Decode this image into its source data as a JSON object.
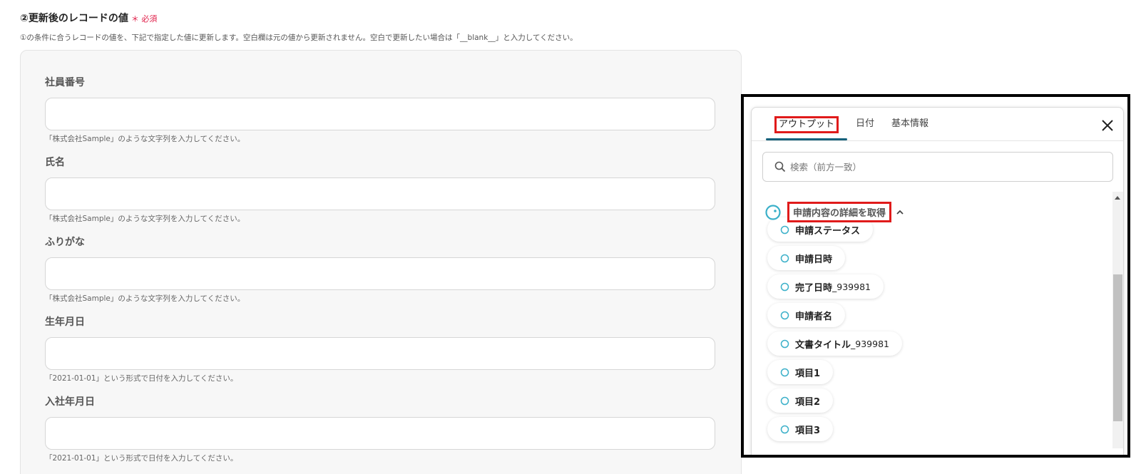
{
  "section": {
    "title": "②更新後のレコードの値",
    "required_mark": "＊ 必須",
    "description": "①の条件に合うレコードの値を、下記で指定した値に更新します。空白欄は元の値から更新されません。空白で更新したい場合は「__blank__」と入力してください。"
  },
  "fields": [
    {
      "label": "社員番号",
      "value": "",
      "hint": "「株式会社Sample」のような文字列を入力してください。"
    },
    {
      "label": "氏名",
      "value": "",
      "hint": "「株式会社Sample」のような文字列を入力してください。"
    },
    {
      "label": "ふりがな",
      "value": "",
      "hint": "「株式会社Sample」のような文字列を入力してください。"
    },
    {
      "label": "生年月日",
      "value": "",
      "hint": "「2021-01-01」という形式で日付を入力してください。"
    },
    {
      "label": "入社年月日",
      "value": "",
      "hint": "「2021-01-01」という形式で日付を入力してください。"
    }
  ],
  "popup": {
    "tabs": [
      {
        "label": "アウトプット",
        "active": true
      },
      {
        "label": "日付",
        "active": false
      },
      {
        "label": "基本情報",
        "active": false
      }
    ],
    "search_placeholder": "検索（前方一致）",
    "group": {
      "title": "申請内容の詳細を取得",
      "items": [
        {
          "label": "申請ステータス",
          "suffix": ""
        },
        {
          "label": "申請日時",
          "suffix": ""
        },
        {
          "label": "完了日時",
          "suffix": "_939981"
        },
        {
          "label": "申請者名",
          "suffix": ""
        },
        {
          "label": "文書タイトル",
          "suffix": "_939981"
        },
        {
          "label": "項目1",
          "suffix": ""
        },
        {
          "label": "項目2",
          "suffix": ""
        },
        {
          "label": "項目3",
          "suffix": ""
        }
      ]
    }
  },
  "icons": {
    "close": "close-icon",
    "search": "search-icon",
    "group": "output-node-icon",
    "chevron": "chevron-up-icon",
    "item": "output-item-icon"
  },
  "colors": {
    "required": "#e0204a",
    "highlight": "#e01b1b",
    "active_tab_underline": "#15617b",
    "icon_teal": "#3bb0c9"
  }
}
